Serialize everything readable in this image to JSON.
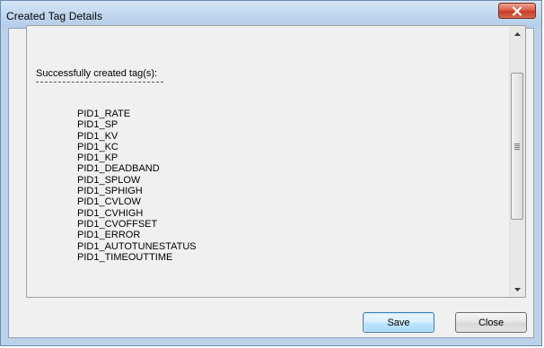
{
  "window": {
    "title": "Created Tag Details",
    "close_glyph": "x"
  },
  "content": {
    "heading": "Successfully created tag(s):",
    "tags": [
      "PID1_RATE",
      "PID1_SP",
      "PID1_KV",
      "PID1_KC",
      "PID1_KP",
      "PID1_DEADBAND",
      "PID1_SPLOW",
      "PID1_SPHIGH",
      "PID1_CVLOW",
      "PID1_CVHIGH",
      "PID1_CVOFFSET",
      "PID1_ERROR",
      "PID1_AUTOTUNESTATUS",
      "PID1_TIMEOUTTIME"
    ]
  },
  "buttons": {
    "save_label": "Save",
    "close_label": "Close"
  },
  "icons": {
    "close": "close-icon",
    "scroll_up": "scroll-up-arrow-icon",
    "scroll_down": "scroll-down-arrow-icon",
    "grip": "scrollbar-grip-icon"
  },
  "colors": {
    "title_bar": "#c3d8ef",
    "close_button": "#c63d26",
    "default_button_border": "#3c7fb1"
  }
}
